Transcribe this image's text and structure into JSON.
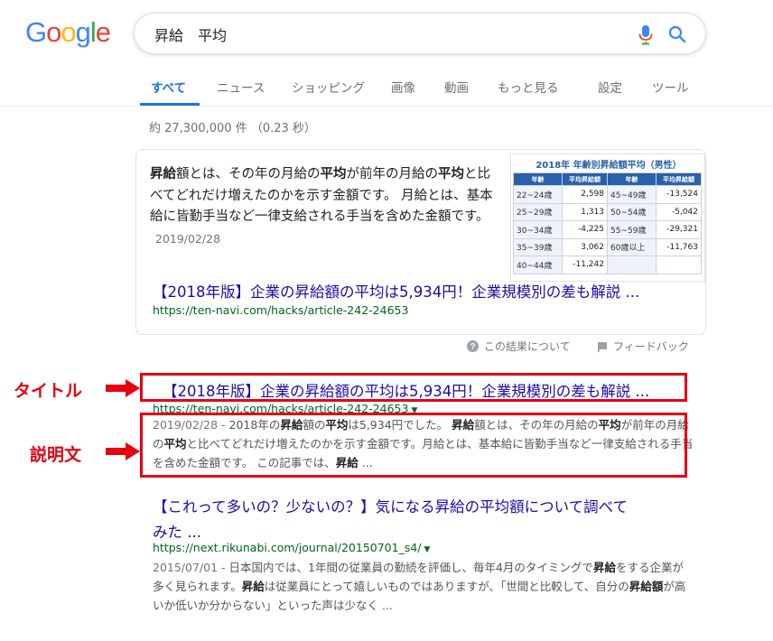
{
  "logo": {
    "letters": [
      "G",
      "o",
      "o",
      "g",
      "l",
      "e"
    ],
    "colors": [
      "#4285F4",
      "#EA4335",
      "#FBBC05",
      "#4285F4",
      "#34A853",
      "#EA4335"
    ]
  },
  "search": {
    "query": "昇給　平均",
    "mic_icon": "mic-icon",
    "search_icon": "search-icon"
  },
  "tabs": [
    {
      "label": "すべて",
      "active": true
    },
    {
      "label": "ニュース"
    },
    {
      "label": "ショッピング"
    },
    {
      "label": "画像"
    },
    {
      "label": "動画"
    },
    {
      "label": "もっと見る"
    },
    {
      "label": "設定"
    },
    {
      "label": "ツール"
    }
  ],
  "stats": "約 27,300,000 件 （0.23 秒）",
  "snippet": {
    "text_parts": [
      {
        "t": "昇給",
        "b": true
      },
      {
        "t": "額とは、その年の月給の"
      },
      {
        "t": "平均",
        "b": true
      },
      {
        "t": "が前年の月給の"
      },
      {
        "t": "平均",
        "b": true
      },
      {
        "t": "と比べてどれだけ増えたのかを示す金額です。 月給とは、基本給に皆勤手当など一律支給される手当を含めた金額です。"
      }
    ],
    "date": "2019/02/28",
    "title": "【2018年版】企業の昇給額の平均は5,934円！企業規模別の差も解説 ...",
    "url": "https://ten-navi.com/hacks/article-242-24653",
    "table": {
      "title": "2018年  年齢別昇給額平均（男性）",
      "headers": [
        "年齢",
        "平均昇給額",
        "年齢",
        "平均昇給額"
      ],
      "rows": [
        [
          "22~24歳",
          "2,598",
          "45~49歳",
          "-13,524"
        ],
        [
          "25~29歳",
          "1,313",
          "50~54歳",
          "-5,042"
        ],
        [
          "30~34歳",
          "-4,225",
          "55~59歳",
          "-29,321"
        ],
        [
          "35~39歳",
          "3,062",
          "60歳以上",
          "-11,763"
        ],
        [
          "40~44歳",
          "-11,242",
          "",
          ""
        ]
      ]
    }
  },
  "feedback": {
    "about": "この結果について",
    "feedback": "フィードバック"
  },
  "results": [
    {
      "title": "【2018年版】企業の昇給額の平均は5,934円！企業規模別の差も解説 ...",
      "url": "https://ten-navi.com/hacks/article-242-24653",
      "desc_parts": [
        {
          "t": "2019/02/28 - ",
          "d": true
        },
        {
          "t": "2018年の"
        },
        {
          "t": "昇給",
          "b": true
        },
        {
          "t": "額の"
        },
        {
          "t": "平均",
          "b": true
        },
        {
          "t": "は5,934円でした。 "
        },
        {
          "t": "昇給",
          "b": true
        },
        {
          "t": "額とは、その年の月給の"
        },
        {
          "t": "平均",
          "b": true
        },
        {
          "t": "が前年の月給の"
        },
        {
          "t": "平均",
          "b": true
        },
        {
          "t": "と比べてどれだけ増えたのかを示す金額です。月給とは、基本給に皆勤手当など一律支給される手当を含めた金額です。 この記事では、"
        },
        {
          "t": "昇給",
          "b": true
        },
        {
          "t": " ..."
        }
      ]
    },
    {
      "title_line1": "【これって多いの？少ないの？】気になる昇給の平均額について調べて",
      "title_line2": "みた ...",
      "url": "https://next.rikunabi.com/journal/20150701_s4/",
      "desc_parts": [
        {
          "t": "2015/07/01 - ",
          "d": true
        },
        {
          "t": "日本国内では、1年間の従業員の勤続を評価し、毎年4月のタイミングで"
        },
        {
          "t": "昇給",
          "b": true
        },
        {
          "t": "をする企業が多く見られます。"
        },
        {
          "t": "昇給",
          "b": true
        },
        {
          "t": "は従業員にとって嬉しいものではありますが、「世間と比較して、自分の"
        },
        {
          "t": "昇給",
          "b": true
        },
        {
          "t": "額",
          "b": true
        },
        {
          "t": "が高いか低いか分からない」といった声は少なく ..."
        }
      ]
    }
  ],
  "annotations": {
    "title_label": "タイトル",
    "desc_label": "説明文",
    "color": "#e60012"
  }
}
